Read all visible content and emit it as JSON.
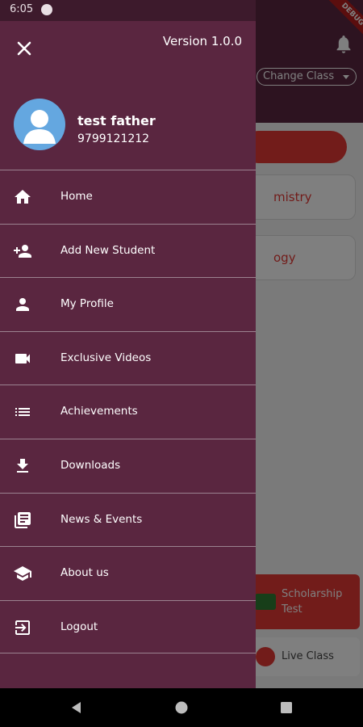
{
  "status_bar": {
    "time": "6:05"
  },
  "background": {
    "change_class_label": "Change Class",
    "subjects": [
      "mistry",
      "ogy"
    ],
    "scholarship_label": "Scholarship Test",
    "live_class_label": "Live Class",
    "debug_banner": "DEBUG"
  },
  "drawer": {
    "version": "Version 1.0.0",
    "user": {
      "name": "test father",
      "phone": "9799121212"
    },
    "menu": [
      {
        "label": "Home",
        "icon": "home-icon"
      },
      {
        "label": "Add New Student",
        "icon": "person-add-icon"
      },
      {
        "label": "My Profile",
        "icon": "person-icon"
      },
      {
        "label": "Exclusive Videos",
        "icon": "videocam-icon"
      },
      {
        "label": "Achievements",
        "icon": "list-icon"
      },
      {
        "label": "Downloads",
        "icon": "download-icon"
      },
      {
        "label": "News & Events",
        "icon": "news-icon"
      },
      {
        "label": "About us",
        "icon": "school-icon"
      },
      {
        "label": "Logout",
        "icon": "logout-icon"
      }
    ]
  },
  "colors": {
    "primary": "#5a2640",
    "accent": "#e53935",
    "divider": "#9b8290"
  }
}
